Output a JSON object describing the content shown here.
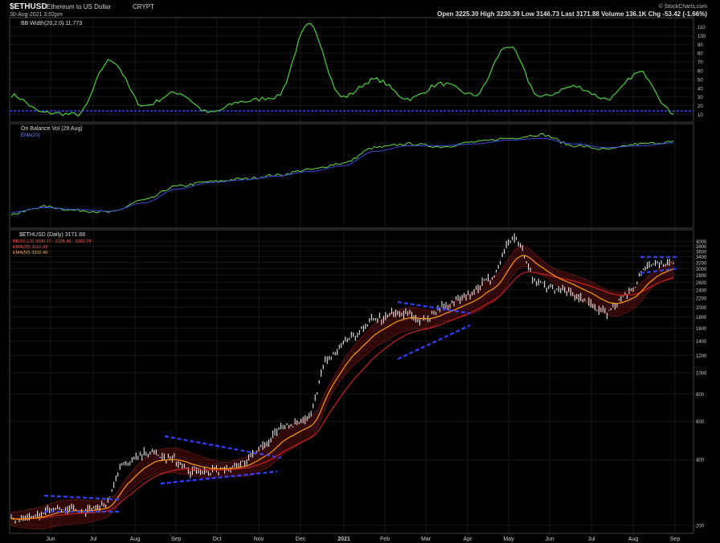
{
  "header": {
    "symbol": "$ETHUSD",
    "name": "Ethereum to US Dollar",
    "exchange": "CRYPT",
    "datetime": "30-Aug-2021 3:02pm",
    "watermark": "© StockCharts.com",
    "quote": "Open 3225.30  High 3230.39  Low 3146.73  Last 3171.88  Volume 136.1K  Chg -53.42 (-1.66%)"
  },
  "panels": {
    "bbwidth": {
      "label": "BB Width(20,2.0) 11.773",
      "ticks": [
        110,
        100,
        90,
        80,
        70,
        60,
        50,
        40,
        30,
        20,
        10
      ]
    },
    "obv": {
      "label": "On Balance Vol (29 Aug)",
      "legend2": "EMA(20)"
    },
    "price": {
      "label": "$ETHUSD (Daily) 3171.88",
      "legend": [
        "BB(20,2.0) 3030.17 - 3195.46 - 3360.74",
        "EMA(20) 3121.39",
        "EMA(50) 3202.40"
      ],
      "ticks": [
        "4000",
        "3800",
        "3600",
        "3400",
        "3200",
        "3000",
        "2800",
        "2600",
        "2400",
        "2200",
        "2000",
        "1800",
        "1600",
        "1400",
        "1200",
        "1000",
        "800",
        "600",
        "400",
        "200"
      ]
    }
  },
  "xaxis": {
    "labels": [
      "Jun",
      "Jul",
      "Aug",
      "Sep",
      "Oct",
      "Nov",
      "Dec",
      "2021",
      "Feb",
      "Mar",
      "Apr",
      "May",
      "Jun",
      "Jul",
      "Aug",
      "Sep"
    ]
  },
  "colors": {
    "bg": "#000000",
    "bbw": "#49d13a",
    "obv": "#5fdc45",
    "ema": "#3b4bdc",
    "price": "#ffffff",
    "ema_fast": "#ff9900",
    "ema_slow": "#cc1f1f",
    "band": "#5a0f0f",
    "trend": "#3340ff",
    "grid": "#2a2a2a"
  },
  "chart_data": [
    {
      "type": "line",
      "title": "BB Width(20,2.0) 11.773",
      "x": [
        "Jun",
        "Jul",
        "Aug",
        "Sep",
        "Oct",
        "Nov",
        "Dec",
        "2021",
        "Feb",
        "Mar",
        "Apr",
        "May",
        "Jun",
        "Jul",
        "Aug",
        "Sep"
      ],
      "series": [
        {
          "name": "BB Width(20,2.0)",
          "values": [
            32,
            12,
            10,
            72,
            20,
            35,
            12,
            25,
            30,
            112,
            30,
            50,
            28,
            45,
            32,
            88,
            30,
            42,
            28,
            58,
            12
          ]
        }
      ],
      "ylim": [
        5,
        115
      ]
    },
    {
      "type": "line",
      "title": "On Balance Vol (29 Aug)",
      "series": [
        {
          "name": "On Balance Vol",
          "values": [
            10,
            18,
            14,
            12,
            25,
            40,
            45,
            48,
            52,
            58,
            65,
            82,
            86,
            83,
            88,
            92,
            96,
            84,
            80,
            86,
            88
          ]
        },
        {
          "name": "EMA(20)",
          "values": [
            12,
            17,
            15,
            13,
            22,
            37,
            44,
            47,
            51,
            56,
            62,
            78,
            84,
            84,
            86,
            90,
            92,
            86,
            82,
            84,
            87
          ]
        }
      ]
    },
    {
      "type": "line",
      "title": "$ETHUSD (Daily) 3171.88",
      "y_scale": "log",
      "ylim": [
        190,
        4300
      ],
      "series": [
        {
          "name": "$ETHUSD",
          "values": [
            210,
            220,
            240,
            235,
            245,
            380,
            430,
            400,
            350,
            355,
            380,
            460,
            570,
            620,
            1200,
            1500,
            1750,
            1900,
            1750,
            2000,
            2300,
            2700,
            4100,
            2600,
            2400,
            2200,
            1900,
            2300,
            3200,
            3170
          ]
        }
      ]
    }
  ]
}
